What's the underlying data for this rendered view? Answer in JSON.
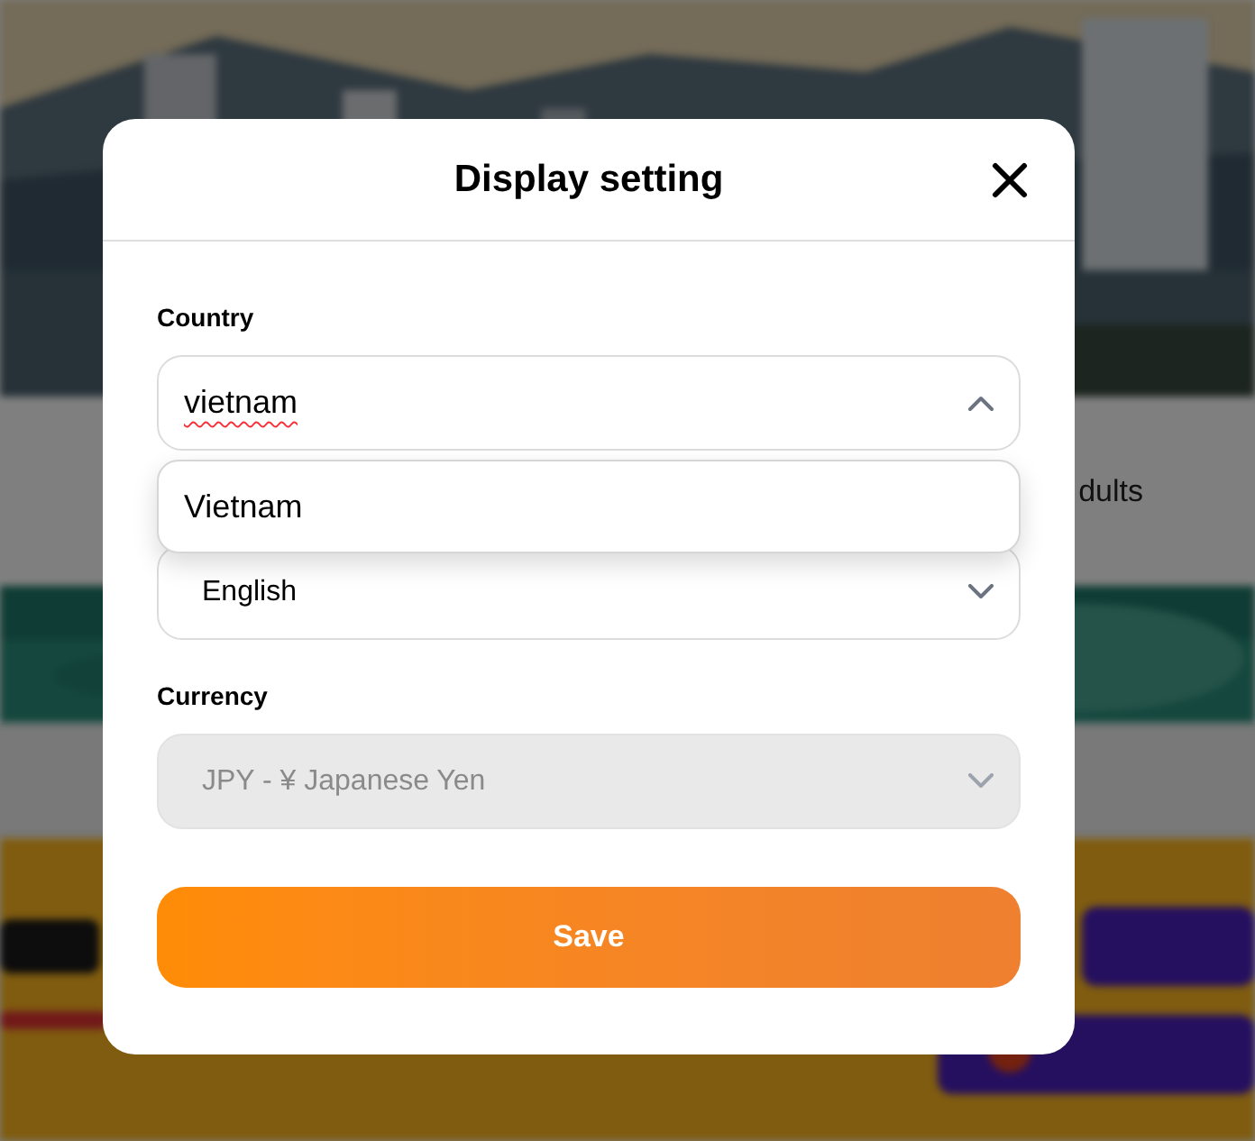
{
  "background": {
    "search_hint": "dults"
  },
  "dialog": {
    "title": "Display setting",
    "fields": [
      {
        "label": "Country",
        "value": "vietnam",
        "expanded": true,
        "disabled": false,
        "options": [
          "Vietnam"
        ]
      },
      {
        "value": "English",
        "expanded": false,
        "disabled": false
      },
      {
        "label": "Currency",
        "value": "JPY - ¥ Japanese Yen",
        "expanded": false,
        "disabled": true
      }
    ],
    "save_button": "Save"
  }
}
